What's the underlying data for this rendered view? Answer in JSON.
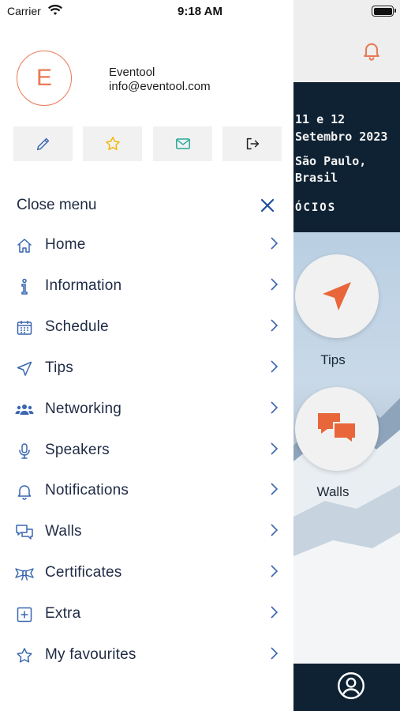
{
  "status_bar": {
    "carrier": "Carrier",
    "time": "9:18 AM"
  },
  "user": {
    "initial": "E",
    "name": "Eventool",
    "email": "info@eventool.com"
  },
  "actions": [
    {
      "icon": "pencil-icon"
    },
    {
      "icon": "star-icon"
    },
    {
      "icon": "envelope-icon"
    },
    {
      "icon": "logout-icon"
    }
  ],
  "close_menu": {
    "label": "Close menu"
  },
  "menu": [
    {
      "label": "Home",
      "icon": "home-icon"
    },
    {
      "label": "Information",
      "icon": "info-icon"
    },
    {
      "label": "Schedule",
      "icon": "calendar-icon"
    },
    {
      "label": "Tips",
      "icon": "location-arrow-icon"
    },
    {
      "label": "Networking",
      "icon": "people-icon"
    },
    {
      "label": "Speakers",
      "icon": "microphone-icon"
    },
    {
      "label": "Notifications",
      "icon": "bell-icon"
    },
    {
      "label": "Walls",
      "icon": "chat-icon"
    },
    {
      "label": "Certificates",
      "icon": "ribbon-icon"
    },
    {
      "label": "Extra",
      "icon": "plus-square-icon"
    },
    {
      "label": "My favourites",
      "icon": "star-icon"
    }
  ],
  "background": {
    "banner_lines": [
      "11 e 12",
      "Setembro 2023",
      "São Paulo,",
      "Brasil",
      "ÓCIOS"
    ],
    "tiles": [
      {
        "label": "Tips",
        "icon": "location-arrow-icon"
      },
      {
        "label": "Walls",
        "icon": "chat-icon"
      }
    ]
  },
  "colors": {
    "accent": "#e87a55",
    "navy": "#1f2a44",
    "dark_banner": "#0f2233",
    "icon_blue": "#3a66b0",
    "icon_yellow": "#f2b705",
    "icon_teal": "#2aa99a"
  }
}
